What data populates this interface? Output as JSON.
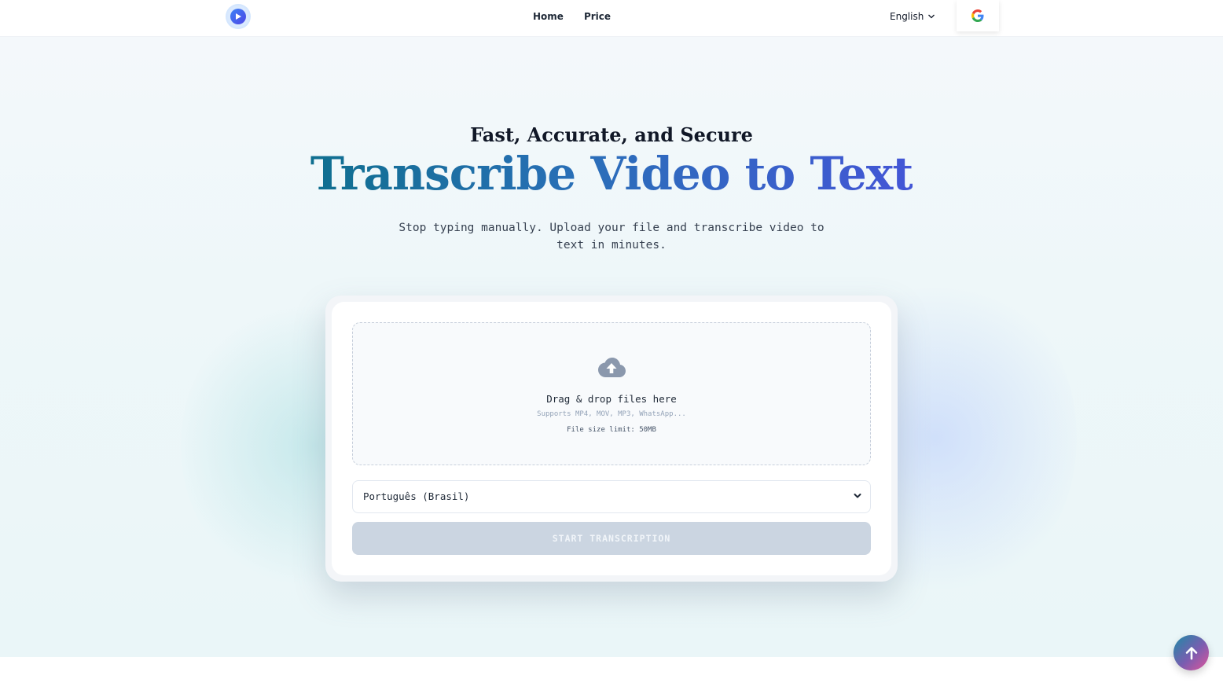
{
  "header": {
    "logo_icon": "play-circle-icon",
    "nav": [
      {
        "label": "Home"
      },
      {
        "label": "Price"
      }
    ],
    "language": "English",
    "google_icon": "google-icon"
  },
  "hero": {
    "subtitle": "Fast, Accurate, and Secure",
    "title": "Transcribe Video to Text",
    "description": "Stop typing manually. Upload your file and transcribe video to text in minutes."
  },
  "upload": {
    "icon": "cloud-upload-icon",
    "title": "Drag & drop files here",
    "supports": "Supports MP4, MOV, MP3, WhatsApp...",
    "limit": "File size limit: 50MB"
  },
  "language_select": {
    "value": "Português (Brasil)"
  },
  "start_button": {
    "label": "START TRANSCRIPTION"
  },
  "colors": {
    "title_gradient_start": "#0f6f8f",
    "title_gradient_end": "#4356d6",
    "button_disabled": "#cbd5e1"
  }
}
